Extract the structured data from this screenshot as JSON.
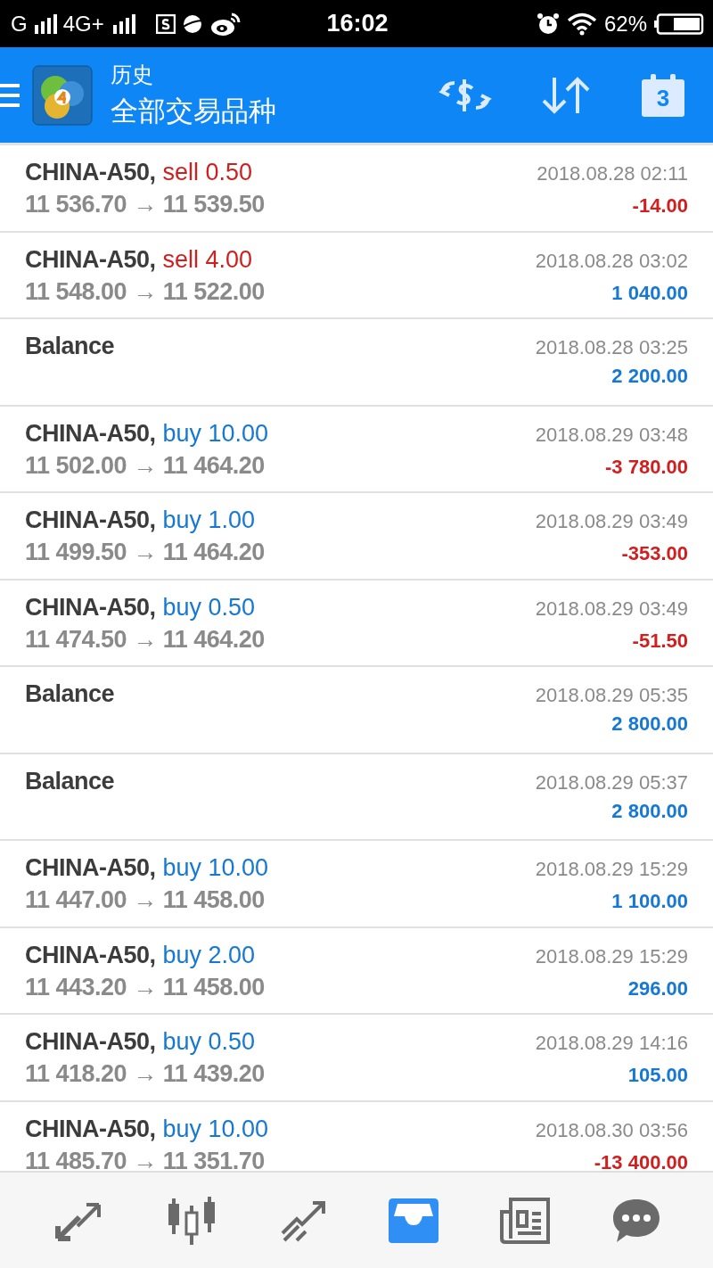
{
  "status_bar": {
    "carrier_1": "G",
    "carrier_2": "4G+",
    "time": "16:02",
    "battery": "62%"
  },
  "header": {
    "title": "历史",
    "subtitle": "全部交易品种",
    "calendar_day": "3"
  },
  "rows": [
    {
      "kind": "trade",
      "symbol": "CHINA-A50,",
      "side": "sell",
      "volume": "0.50",
      "prices": "11 536.70 → 11 539.50",
      "time": "2018.08.28 02:11",
      "profit": "-14.00",
      "loss": true
    },
    {
      "kind": "trade",
      "symbol": "CHINA-A50,",
      "side": "sell",
      "volume": "4.00",
      "prices": "11 548.00 → 11 522.00",
      "time": "2018.08.28 03:02",
      "profit": "1 040.00",
      "loss": false
    },
    {
      "kind": "balance",
      "symbol": "Balance",
      "time": "2018.08.28 03:25",
      "profit": "2 200.00",
      "loss": false
    },
    {
      "kind": "trade",
      "symbol": "CHINA-A50,",
      "side": "buy",
      "volume": "10.00",
      "prices": "11 502.00 → 11 464.20",
      "time": "2018.08.29 03:48",
      "profit": "-3 780.00",
      "loss": true
    },
    {
      "kind": "trade",
      "symbol": "CHINA-A50,",
      "side": "buy",
      "volume": "1.00",
      "prices": "11 499.50 → 11 464.20",
      "time": "2018.08.29 03:49",
      "profit": "-353.00",
      "loss": true
    },
    {
      "kind": "trade",
      "symbol": "CHINA-A50,",
      "side": "buy",
      "volume": "0.50",
      "prices": "11 474.50 → 11 464.20",
      "time": "2018.08.29 03:49",
      "profit": "-51.50",
      "loss": true
    },
    {
      "kind": "balance",
      "symbol": "Balance",
      "time": "2018.08.29 05:35",
      "profit": "2 800.00",
      "loss": false
    },
    {
      "kind": "balance",
      "symbol": "Balance",
      "time": "2018.08.29 05:37",
      "profit": "2 800.00",
      "loss": false
    },
    {
      "kind": "trade",
      "symbol": "CHINA-A50,",
      "side": "buy",
      "volume": "10.00",
      "prices": "11 447.00 → 11 458.00",
      "time": "2018.08.29 15:29",
      "profit": "1 100.00",
      "loss": false
    },
    {
      "kind": "trade",
      "symbol": "CHINA-A50,",
      "side": "buy",
      "volume": "2.00",
      "prices": "11 443.20 → 11 458.00",
      "time": "2018.08.29 15:29",
      "profit": "296.00",
      "loss": false
    },
    {
      "kind": "trade",
      "symbol": "CHINA-A50,",
      "side": "buy",
      "volume": "0.50",
      "prices": "11 418.20 → 11 439.20",
      "time": "2018.08.29 14:16",
      "profit": "105.00",
      "loss": false
    },
    {
      "kind": "trade",
      "symbol": "CHINA-A50,",
      "side": "buy",
      "volume": "10.00",
      "prices": "11 485.70 → 11 351.70",
      "time": "2018.08.30 03:56",
      "profit": "-13 400.00",
      "loss": true
    }
  ],
  "bottom_nav": [
    {
      "kind": "quotes",
      "selected": false
    },
    {
      "kind": "chart",
      "selected": false
    },
    {
      "kind": "trade",
      "selected": false
    },
    {
      "kind": "history",
      "selected": true
    },
    {
      "kind": "news",
      "selected": false
    },
    {
      "kind": "chat",
      "selected": false
    }
  ]
}
